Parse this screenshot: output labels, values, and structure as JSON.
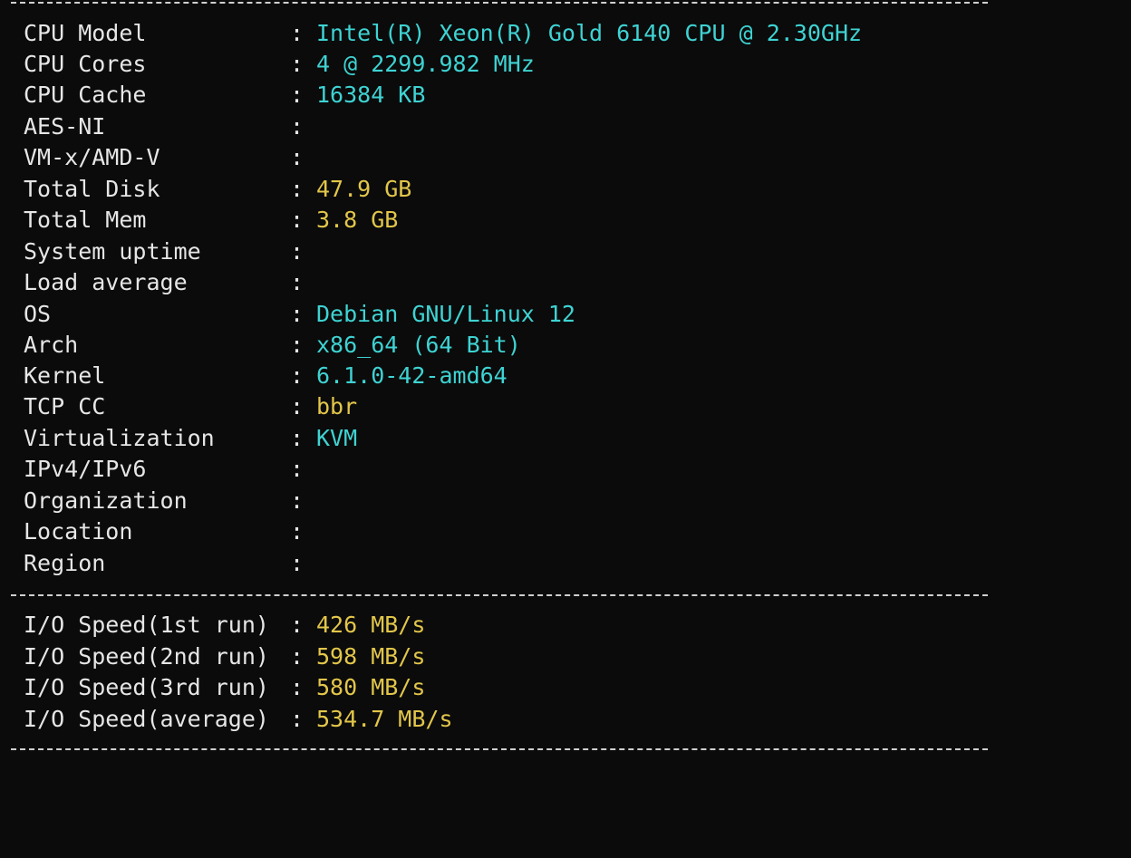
{
  "separator": "-------------------------------------------------------------------",
  "system_info": [
    {
      "label": "CPU Model",
      "value": "Intel(R) Xeon(R) Gold 6140 CPU @ 2.30GHz",
      "color": "cyan"
    },
    {
      "label": "CPU Cores",
      "value": "4 @ 2299.982 MHz",
      "color": "cyan"
    },
    {
      "label": "CPU Cache",
      "value": "16384 KB",
      "color": "cyan"
    },
    {
      "label": "AES-NI",
      "value": "",
      "color": "cyan"
    },
    {
      "label": "VM-x/AMD-V",
      "value": "",
      "color": "cyan"
    },
    {
      "label": "Total Disk",
      "value": "47.9 GB",
      "color": "yellow"
    },
    {
      "label": "Total Mem",
      "value": "3.8 GB",
      "color": "yellow"
    },
    {
      "label": "System uptime",
      "value": "",
      "color": "cyan"
    },
    {
      "label": "Load average",
      "value": "",
      "color": "yellow"
    },
    {
      "label": "OS",
      "value": "Debian GNU/Linux 12",
      "color": "cyan"
    },
    {
      "label": "Arch",
      "value": "x86_64 (64 Bit)",
      "color": "cyan"
    },
    {
      "label": "Kernel",
      "value": "6.1.0-42-amd64",
      "color": "cyan"
    },
    {
      "label": "TCP CC",
      "value": "bbr",
      "color": "yellow"
    },
    {
      "label": "Virtualization",
      "value": "KVM",
      "color": "cyan"
    },
    {
      "label": "IPv4/IPv6",
      "value": "",
      "color": "cyan"
    },
    {
      "label": "Organization",
      "value": "",
      "color": "cyan"
    },
    {
      "label": "Location",
      "value": "",
      "color": "cyan"
    },
    {
      "label": "Region",
      "value": "",
      "color": "cyan"
    }
  ],
  "io_speed": [
    {
      "label": "I/O Speed(1st run)",
      "value": "426 MB/s",
      "color": "yellow"
    },
    {
      "label": "I/O Speed(2nd run)",
      "value": "598 MB/s",
      "color": "yellow"
    },
    {
      "label": "I/O Speed(3rd run)",
      "value": "580 MB/s",
      "color": "yellow"
    },
    {
      "label": "I/O Speed(average)",
      "value": "534.7 MB/s",
      "color": "yellow"
    }
  ],
  "colors": {
    "background": "#0b0b0b",
    "text": "#e6e6e6",
    "cyan": "#3fd3d3",
    "yellow": "#e2c64a"
  },
  "colon": ":"
}
